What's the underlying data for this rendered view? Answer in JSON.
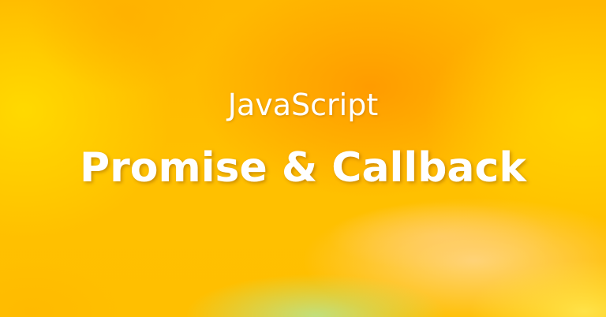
{
  "banner": {
    "subtitle": "JavaScript",
    "title": "Promise & Callback"
  },
  "colors": {
    "text": "#ffffff",
    "background_main": "#ffc000",
    "background_deep": "#ff9600",
    "background_light": "#ffdc00",
    "accent_green": "#bee182",
    "accent_peach": "#ffd78c"
  }
}
